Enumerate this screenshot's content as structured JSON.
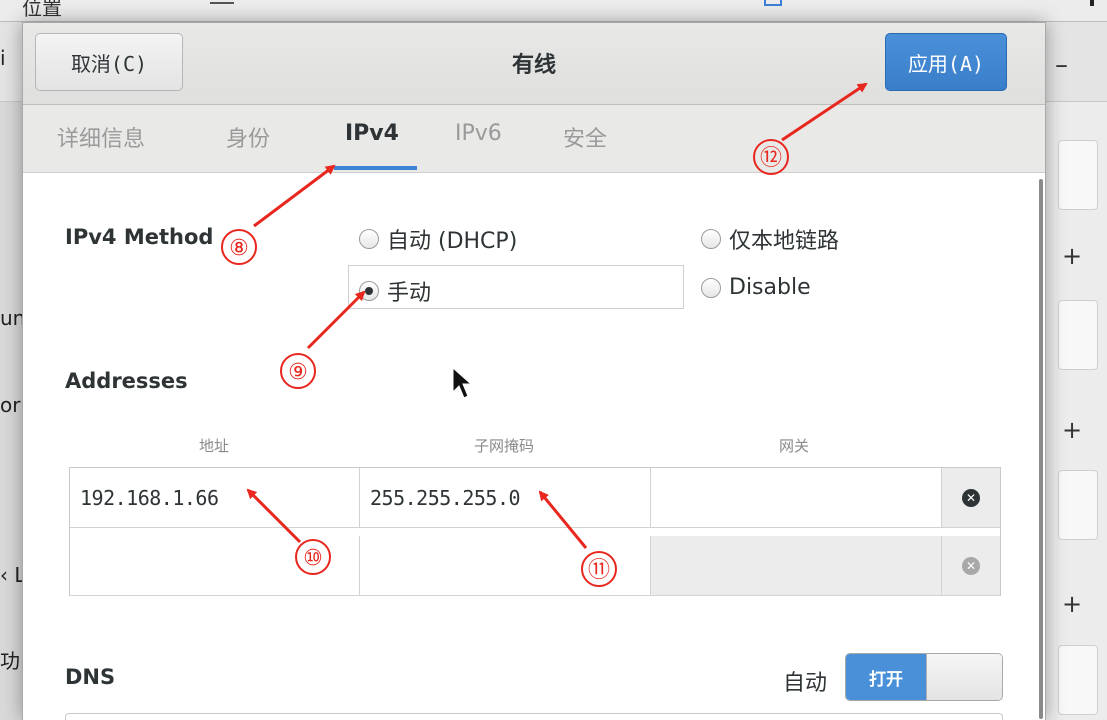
{
  "background": {
    "top_label": "位置",
    "left_fragments": [
      "i",
      "un",
      "or",
      "‹ L",
      "功"
    ],
    "plus_label": "+",
    "minus_label": "–"
  },
  "dialog": {
    "title": "有线",
    "cancel_label": "取消(C)",
    "apply_label": "应用(A)"
  },
  "tabs": [
    {
      "label": "详细信息",
      "active": false
    },
    {
      "label": "身份",
      "active": false
    },
    {
      "label": "IPv4",
      "active": true
    },
    {
      "label": "IPv6",
      "active": false
    },
    {
      "label": "安全",
      "active": false
    }
  ],
  "ipv4": {
    "method_label": "IPv4 Method",
    "options": [
      {
        "label": "自动 (DHCP)",
        "checked": false
      },
      {
        "label": "仅本地链路",
        "checked": false
      },
      {
        "label": "手动",
        "checked": true
      },
      {
        "label": "Disable",
        "checked": false
      }
    ]
  },
  "addresses": {
    "title": "Addresses",
    "columns": [
      "地址",
      "子网掩码",
      "网关"
    ],
    "rows": [
      {
        "address": "192.168.1.66",
        "netmask": "255.255.255.0",
        "gateway": ""
      },
      {
        "address": "",
        "netmask": "",
        "gateway": ""
      }
    ]
  },
  "dns": {
    "title": "DNS",
    "auto_label": "自动",
    "switch_on_label": "打开",
    "auto_enabled": true
  },
  "annotations": [
    "⑧",
    "⑨",
    "⑩",
    "⑪",
    "⑫"
  ],
  "colors": {
    "accent": "#4a90d9",
    "annotation_red": "#e8271f"
  }
}
